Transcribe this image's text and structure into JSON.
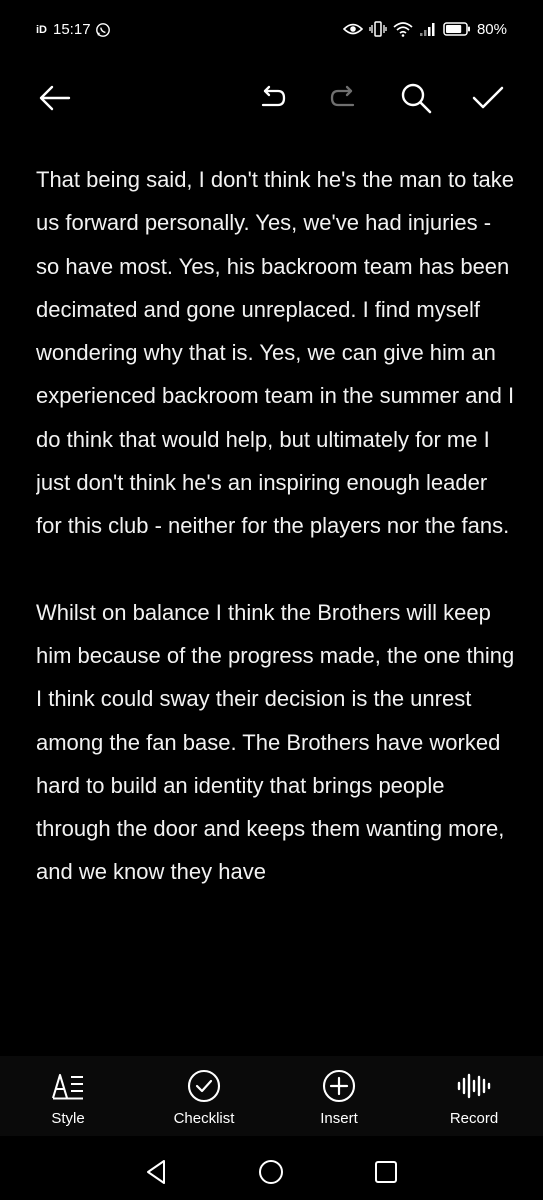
{
  "status_bar": {
    "carrier_tag": "iD",
    "time": "15:17",
    "battery_percent": "80%",
    "battery_level": 0.8,
    "icons": [
      "whatsapp-icon",
      "eye-icon",
      "vibrate-icon",
      "wifi-icon",
      "signal-icon",
      "battery-icon"
    ]
  },
  "toolbar": {
    "icons": [
      "back-arrow-icon",
      "undo-icon",
      "redo-icon",
      "search-icon",
      "check-icon"
    ]
  },
  "content": {
    "paragraphs": [
      "That being said, I don't think he's the man to take us forward personally. Yes, we've had injuries - so have most. Yes, his backroom team has been decimated and gone unreplaced. I find myself wondering why that is. Yes, we can give him an experienced backroom team in the summer and I do think that would help, but ultimately for me I just don't think he's an inspiring enough leader for this club - neither for the players nor the fans.",
      "Whilst on balance I think the Brothers will keep him because of the progress made, the one thing I think could sway their decision is the unrest among the fan base. The Brothers have worked hard to build an identity that brings people through the door and keeps them wanting more, and we know they have"
    ]
  },
  "bottom_bar": {
    "style_label": "Style",
    "checklist_label": "Checklist",
    "insert_label": "Insert",
    "record_label": "Record"
  },
  "nav_bar": {
    "icons": [
      "back-triangle-icon",
      "home-circle-icon",
      "recents-square-icon"
    ]
  },
  "colors": {
    "background": "#000000",
    "text": "#f2f2f2",
    "disabled": "#7a7a7a"
  }
}
